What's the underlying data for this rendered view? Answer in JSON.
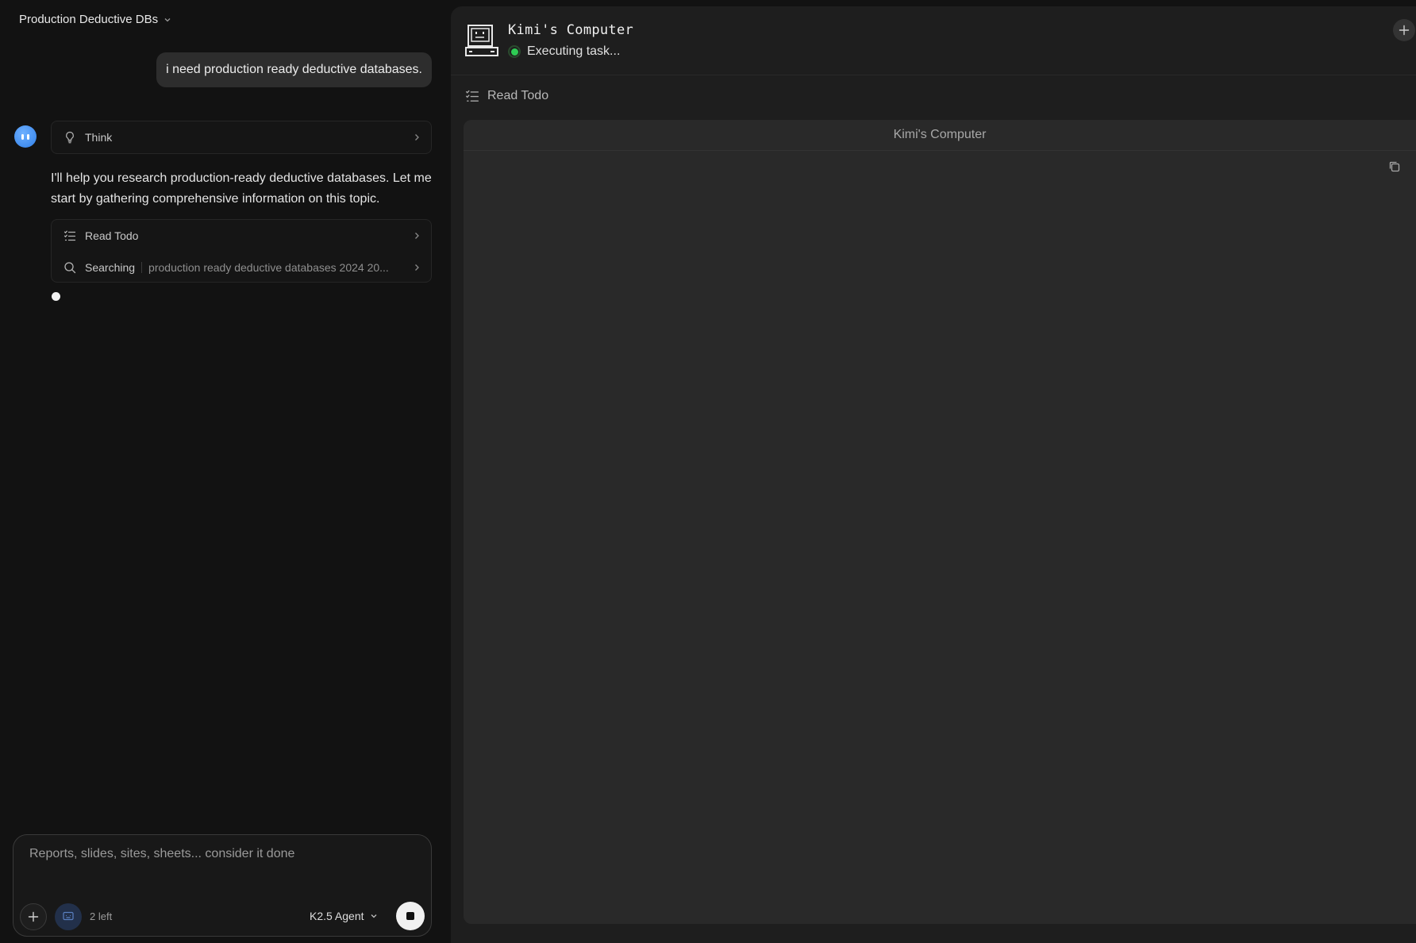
{
  "project": {
    "title": "Production Deductive DBs"
  },
  "chat": {
    "user_message": "i need production ready deductive databases.",
    "think_label": "Think",
    "assistant_message": "I'll help you research production-ready deductive databases. Let me start by gathering comprehensive information on this topic.",
    "steps": [
      {
        "label": "Read Todo",
        "icon": "checklist-icon"
      },
      {
        "label": "Searching",
        "detail": "production ready deductive databases 2024 20...",
        "icon": "search-icon"
      }
    ]
  },
  "composer": {
    "placeholder": "Reports, slides, sites, sheets... consider it done",
    "quota": "2 left",
    "model": "K2.5 Agent"
  },
  "computer": {
    "title": "Kimi's Computer",
    "status": "Executing task...",
    "status_color": "#2ecc54",
    "current_tool": "Read Todo",
    "viewer_title": "Kimi's Computer"
  }
}
